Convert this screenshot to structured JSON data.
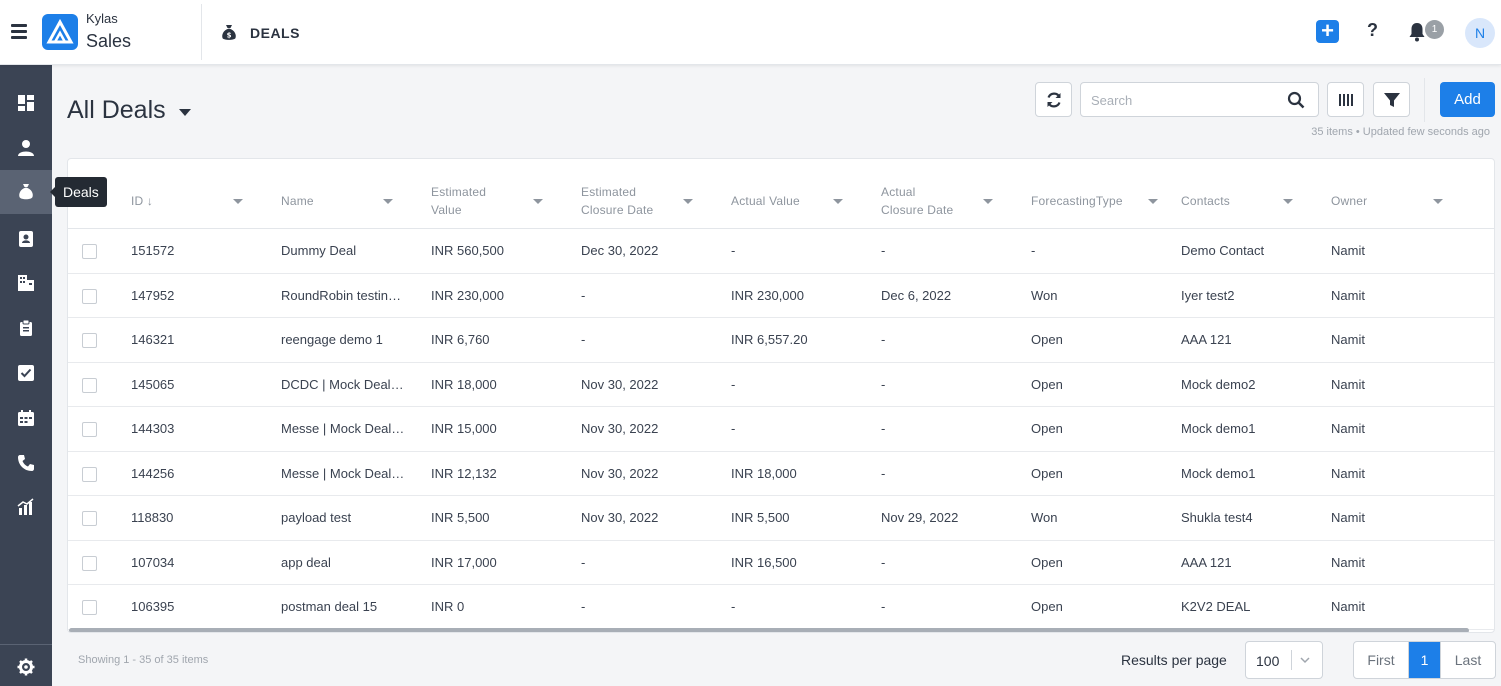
{
  "header": {
    "brand_top": "Kylas",
    "brand_bottom": "Sales",
    "module_title": "DEALS",
    "notification_count": "1",
    "avatar_initial": "N",
    "quick_add_label": "+",
    "help_label": "?"
  },
  "sidebar": {
    "items": [
      {
        "icon": "dashboard-icon"
      },
      {
        "icon": "user-icon"
      },
      {
        "icon": "money-bag-icon",
        "active": true
      },
      {
        "icon": "contact-card-icon"
      },
      {
        "icon": "building-icon"
      },
      {
        "icon": "clipboard-icon"
      },
      {
        "icon": "checkbox-task-icon"
      },
      {
        "icon": "calendar-icon"
      },
      {
        "icon": "phone-icon"
      },
      {
        "icon": "reports-icon"
      }
    ],
    "tooltip": "Deals",
    "settings_icon": "gear-icon"
  },
  "page": {
    "title": "All Deals",
    "search_placeholder": "Search",
    "add_label": "Add",
    "meta": "35 items • Updated few seconds ago"
  },
  "table": {
    "columns": [
      {
        "label": "ID ↓"
      },
      {
        "label": "Name"
      },
      {
        "label": "Estimated\nValue"
      },
      {
        "label": "Estimated\nClosure Date"
      },
      {
        "label": "Actual Value"
      },
      {
        "label": "Actual\nClosure Date"
      },
      {
        "label": "ForecastingType"
      },
      {
        "label": "Contacts"
      },
      {
        "label": "Owner"
      }
    ],
    "rows": [
      {
        "id": "151572",
        "name": "Dummy Deal",
        "est_value": "INR 560,500",
        "est_date": "Dec 30, 2022",
        "act_value": "-",
        "act_date": "-",
        "forecast": "-",
        "contact": "Demo Contact",
        "owner": "Namit"
      },
      {
        "id": "147952",
        "name": "RoundRobin testin…",
        "est_value": "INR 230,000",
        "est_date": "-",
        "act_value": "INR 230,000",
        "act_date": "Dec 6, 2022",
        "forecast": "Won",
        "contact": "Iyer test2",
        "owner": "Namit"
      },
      {
        "id": "146321",
        "name": "reengage demo 1",
        "est_value": "INR 6,760",
        "est_date": "-",
        "act_value": "INR 6,557.20",
        "act_date": "-",
        "forecast": "Open",
        "contact": "AAA 121",
        "owner": "Namit"
      },
      {
        "id": "145065",
        "name": "DCDC | Mock Deal …",
        "est_value": "INR 18,000",
        "est_date": "Nov 30, 2022",
        "act_value": "-",
        "act_date": "-",
        "forecast": "Open",
        "contact": "Mock demo2",
        "owner": "Namit"
      },
      {
        "id": "144303",
        "name": "Messe | Mock Deal …",
        "est_value": "INR 15,000",
        "est_date": "Nov 30, 2022",
        "act_value": "-",
        "act_date": "-",
        "forecast": "Open",
        "contact": "Mock demo1",
        "owner": "Namit"
      },
      {
        "id": "144256",
        "name": "Messe | Mock Deal …",
        "est_value": "INR 12,132",
        "est_date": "Nov 30, 2022",
        "act_value": "INR 18,000",
        "act_date": "-",
        "forecast": "Open",
        "contact": "Mock demo1",
        "owner": "Namit"
      },
      {
        "id": "118830",
        "name": "payload test",
        "est_value": "INR 5,500",
        "est_date": "Nov 30, 2022",
        "act_value": "INR 5,500",
        "act_date": "Nov 29, 2022",
        "forecast": "Won",
        "contact": "Shukla test4",
        "owner": "Namit"
      },
      {
        "id": "107034",
        "name": "app deal",
        "est_value": "INR 17,000",
        "est_date": "-",
        "act_value": "INR 16,500",
        "act_date": "-",
        "forecast": "Open",
        "contact": "AAA 121",
        "owner": "Namit"
      },
      {
        "id": "106395",
        "name": "postman deal 15",
        "est_value": "INR 0",
        "est_date": "-",
        "act_value": "-",
        "act_date": "-",
        "forecast": "Open",
        "contact": "K2V2 DEAL",
        "owner": "Namit"
      }
    ]
  },
  "footer": {
    "showing": "Showing 1 - 35 of 35 items",
    "results_per_page_label": "Results per page",
    "results_per_page_value": "100",
    "pager_first": "First",
    "pager_current": "1",
    "pager_last": "Last"
  },
  "colors": {
    "primary": "#1d7fe8",
    "sidebar_bg": "#3b4454",
    "sidebar_active": "#5a6373"
  }
}
